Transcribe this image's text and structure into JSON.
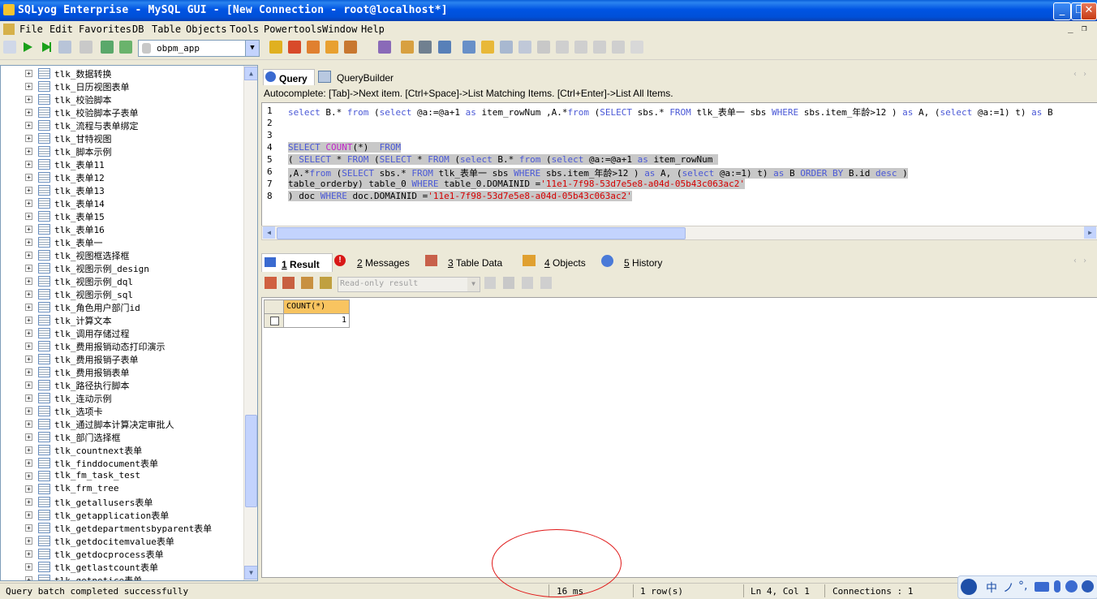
{
  "window": {
    "title": "SQLyog Enterprise - MySQL GUI - [New Connection - root@localhost*]",
    "minimize": "_",
    "restore": "❐",
    "close": "✕"
  },
  "menu": [
    "File",
    "Edit",
    "Favorites",
    "DB",
    "Table",
    "Objects",
    "Tools",
    "Powertools",
    "Window",
    "Help"
  ],
  "toolbar": {
    "database": "obpm_app"
  },
  "tree": {
    "items": [
      "tlk_数据转换",
      "tlk_日历视图表单",
      "tlk_校验脚本",
      "tlk_校验脚本子表单",
      "tlk_流程与表单绑定",
      "tlk_甘特视图",
      "tlk_脚本示例",
      "tlk_表单11",
      "tlk_表单12",
      "tlk_表单13",
      "tlk_表单14",
      "tlk_表单15",
      "tlk_表单16",
      "tlk_表单一",
      "tlk_视图框选择框",
      "tlk_视图示例_design",
      "tlk_视图示例_dql",
      "tlk_视图示例_sql",
      "tlk_角色用户部门id",
      "tlk_计算文本",
      "tlk_调用存储过程",
      "tlk_费用报销动态打印演示",
      "tlk_费用报销子表单",
      "tlk_费用报销表单",
      "tlk_路径执行脚本",
      "tlk_连动示例",
      "tlk_选项卡",
      "tlk_通过脚本计算决定审批人",
      "tlk_部门选择框",
      "tlk_countnext表单",
      "tlk_finddocument表单",
      "tlk_fm_task_test",
      "tlk_frm_tree",
      "tlk_getallusers表单",
      "tlk_getapplication表单",
      "tlk_getdepartmentsbyparent表单",
      "tlk_getdocitemvalue表单",
      "tlk_getdocprocess表单",
      "tlk_getlastcount表单",
      "tlk_getnotice表单"
    ]
  },
  "query_tabs": {
    "query": "Query",
    "builder": "QueryBuilder"
  },
  "autocomplete_hint": "Autocomplete: [Tab]->Next item. [Ctrl+Space]->List Matching Items. [Ctrl+Enter]->List All Items.",
  "editor": {
    "line_numbers": [
      "1",
      "2",
      "3",
      "4",
      "5",
      "6",
      "7",
      "8"
    ]
  },
  "result_tabs": [
    {
      "num": "1",
      "label": "Result"
    },
    {
      "num": "2",
      "label": "Messages"
    },
    {
      "num": "3",
      "label": "Table Data"
    },
    {
      "num": "4",
      "label": "Objects"
    },
    {
      "num": "5",
      "label": "History"
    }
  ],
  "result_toolbar": {
    "mode": "Read-only result"
  },
  "grid": {
    "column": "COUNT(*)",
    "value": "1"
  },
  "status": {
    "message": "Query batch completed successfully",
    "time": "16 ms",
    "rows": "1 row(s)",
    "position": "Ln 4, Col 1",
    "connections": "Connections : 1"
  },
  "ime": {
    "a": "中",
    "b": "ノ",
    "c": "°,"
  }
}
